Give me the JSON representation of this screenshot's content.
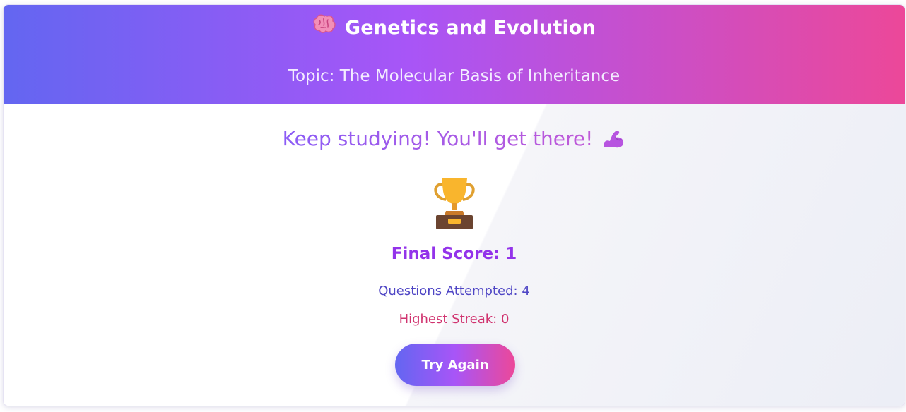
{
  "header": {
    "icon": "brain-icon",
    "title": "Genetics and Evolution",
    "subtitle": "Topic: The Molecular Basis of Inheritance"
  },
  "results": {
    "message": "Keep studying! You'll get there!",
    "message_icon": "flexed-biceps-icon",
    "trophy_icon": "trophy-icon",
    "final_score": "Final Score: 1",
    "questions_attempted": "Questions Attempted: 4",
    "highest_streak": "Highest Streak: 0"
  },
  "actions": {
    "try_again_label": "Try Again"
  },
  "colors": {
    "gradient_start": "#6366f1",
    "gradient_mid": "#a855f7",
    "gradient_end": "#ec4899",
    "score": "#9333ea",
    "attempted": "#4f46c5",
    "streak": "#d0336f"
  }
}
